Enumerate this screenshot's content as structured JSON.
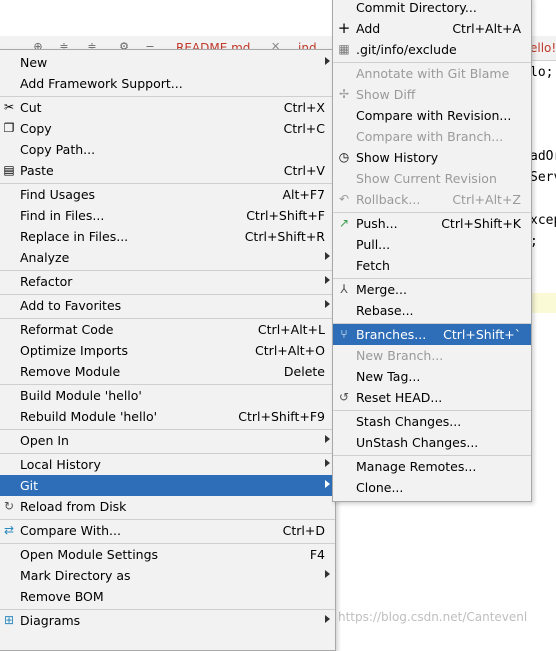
{
  "background": {
    "editor_tabs": [
      {
        "label": "README.md"
      },
      {
        "label": "ind"
      },
      {
        "label": "ello!"
      }
    ],
    "code_lines": [
      {
        "text": "lo;"
      },
      {
        "text": "adOr"
      },
      {
        "text": "Serv"
      },
      {
        "text": "xcep"
      },
      {
        "text": ";"
      }
    ],
    "watermark": "https://blog.csdn.net/Cantevenl"
  },
  "main_menu": {
    "items": [
      {
        "label": "New",
        "shortcut": "",
        "submenu": true
      },
      {
        "label": "Add Framework Support...",
        "shortcut": "",
        "submenu": false
      },
      {
        "label": "Cut",
        "shortcut": "Ctrl+X",
        "icon": "scissors-icon"
      },
      {
        "label": "Copy",
        "shortcut": "Ctrl+C",
        "icon": "copy-icon"
      },
      {
        "label": "Copy Path...",
        "shortcut": ""
      },
      {
        "label": "Paste",
        "shortcut": "Ctrl+V",
        "icon": "paste-icon"
      },
      {
        "label": "Find Usages",
        "shortcut": "Alt+F7"
      },
      {
        "label": "Find in Files...",
        "shortcut": "Ctrl+Shift+F"
      },
      {
        "label": "Replace in Files...",
        "shortcut": "Ctrl+Shift+R"
      },
      {
        "label": "Analyze",
        "shortcut": "",
        "submenu": true
      },
      {
        "label": "Refactor",
        "shortcut": "",
        "submenu": true
      },
      {
        "label": "Add to Favorites",
        "shortcut": "",
        "submenu": true
      },
      {
        "label": "Reformat Code",
        "shortcut": "Ctrl+Alt+L"
      },
      {
        "label": "Optimize Imports",
        "shortcut": "Ctrl+Alt+O"
      },
      {
        "label": "Remove Module",
        "shortcut": "Delete"
      },
      {
        "label": "Build Module 'hello'",
        "shortcut": ""
      },
      {
        "label": "Rebuild Module 'hello'",
        "shortcut": "Ctrl+Shift+F9"
      },
      {
        "label": "Open In",
        "shortcut": "",
        "submenu": true
      },
      {
        "label": "Local History",
        "shortcut": "",
        "submenu": true
      },
      {
        "label": "Git",
        "shortcut": "",
        "submenu": true,
        "highlighted": true
      },
      {
        "label": "Reload from Disk",
        "shortcut": "",
        "icon": "reload-icon"
      },
      {
        "label": "Compare With...",
        "shortcut": "Ctrl+D",
        "icon": "compare-icon"
      },
      {
        "label": "Open Module Settings",
        "shortcut": "F4"
      },
      {
        "label": "Mark Directory as",
        "shortcut": "",
        "submenu": true
      },
      {
        "label": "Remove BOM",
        "shortcut": ""
      },
      {
        "label": "Diagrams",
        "shortcut": "",
        "submenu": true,
        "icon": "diagram-icon"
      }
    ]
  },
  "git_menu": {
    "items": [
      {
        "label": "Commit Directory...",
        "shortcut": ""
      },
      {
        "label": "Add",
        "shortcut": "Ctrl+Alt+A",
        "icon": "plus-icon"
      },
      {
        "label": ".git/info/exclude",
        "shortcut": "",
        "icon": "file-icon"
      },
      {
        "label": "Annotate with Git Blame",
        "shortcut": "",
        "disabled": true
      },
      {
        "label": "Show Diff",
        "shortcut": "",
        "disabled": true,
        "icon": "diff-icon"
      },
      {
        "label": "Compare with Revision...",
        "shortcut": ""
      },
      {
        "label": "Compare with Branch...",
        "shortcut": "",
        "disabled": true
      },
      {
        "label": "Show History",
        "shortcut": "",
        "icon": "clock-icon"
      },
      {
        "label": "Show Current Revision",
        "shortcut": "",
        "disabled": true
      },
      {
        "label": "Rollback...",
        "shortcut": "Ctrl+Alt+Z",
        "disabled": true,
        "icon": "rollback-icon"
      },
      {
        "label": "Push...",
        "shortcut": "Ctrl+Shift+K",
        "icon": "push-icon"
      },
      {
        "label": "Pull...",
        "shortcut": ""
      },
      {
        "label": "Fetch",
        "shortcut": ""
      },
      {
        "label": "Merge...",
        "shortcut": "",
        "icon": "merge-icon"
      },
      {
        "label": "Rebase...",
        "shortcut": ""
      },
      {
        "label": "Branches...",
        "shortcut": "Ctrl+Shift+`",
        "highlighted": true,
        "icon": "branch-icon"
      },
      {
        "label": "New Branch...",
        "shortcut": "",
        "disabled": true
      },
      {
        "label": "New Tag...",
        "shortcut": ""
      },
      {
        "label": "Reset HEAD...",
        "shortcut": "",
        "icon": "reset-icon"
      },
      {
        "label": "Stash Changes...",
        "shortcut": ""
      },
      {
        "label": "UnStash Changes...",
        "shortcut": ""
      },
      {
        "label": "Manage Remotes...",
        "shortcut": ""
      },
      {
        "label": "Clone...",
        "shortcut": ""
      }
    ]
  },
  "colors": {
    "highlight": "#2e6eb8",
    "menu_bg": "#f2f2f2",
    "disabled_text": "#9a9a9a"
  }
}
